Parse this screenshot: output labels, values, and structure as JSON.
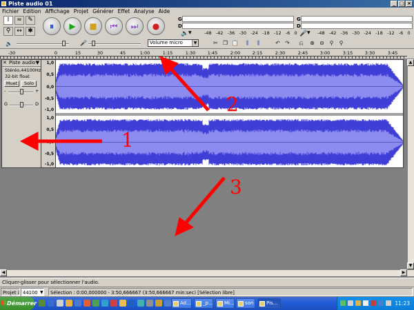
{
  "window": {
    "title": "Piste audio 01"
  },
  "menu": [
    "Fichier",
    "Edition",
    "Affichage",
    "Projet",
    "Générer",
    "Effet",
    "Analyse",
    "Aide"
  ],
  "meters": {
    "out_label_l": "G",
    "out_label_r": "D",
    "scale": [
      "-48",
      "-42",
      "-36",
      "-30",
      "-24",
      "-18",
      "-12",
      "-6",
      "0"
    ]
  },
  "input_source": {
    "selected": "Volume micro"
  },
  "ruler": {
    "ticks": [
      "-30",
      "0",
      "15",
      "30",
      "45",
      "1:00",
      "1:15",
      "1:30",
      "1:45",
      "2:00",
      "2:15",
      "2:30",
      "2:45",
      "3:00",
      "3:15",
      "3:30",
      "3:45"
    ]
  },
  "track": {
    "name": "Piste audio",
    "info1": "Stéréo,44100Hz",
    "info2": "32-bit float",
    "mute_label": "Muet",
    "solo_label": "Solo",
    "gain_label": "G",
    "pan_label_l": "G",
    "pan_label_r": "D",
    "y_ticks": [
      "1,0",
      "0,5",
      "0,0",
      "-0,5",
      "-1,0"
    ],
    "wave_color": "#3f3fd8",
    "wave_light_color": "#8c8cf0"
  },
  "status": {
    "hint": "Cliquer-glisser pour sélectionner l'audio."
  },
  "bottom": {
    "project_label": "Projet à",
    "rate": "44100",
    "selection": "Sélection : 0:00,000000 - 3:50,666667 (3:50,666667 min:sec)  [Sélection libre]"
  },
  "taskbar": {
    "start_label": "Démarrer",
    "tasks": [
      "Ad...",
      "_p...",
      "Mi...",
      "son",
      "Pis..."
    ],
    "clock": "11:23"
  },
  "annotations": [
    "1",
    "2",
    "3"
  ],
  "annotation_color": "#ff0000"
}
